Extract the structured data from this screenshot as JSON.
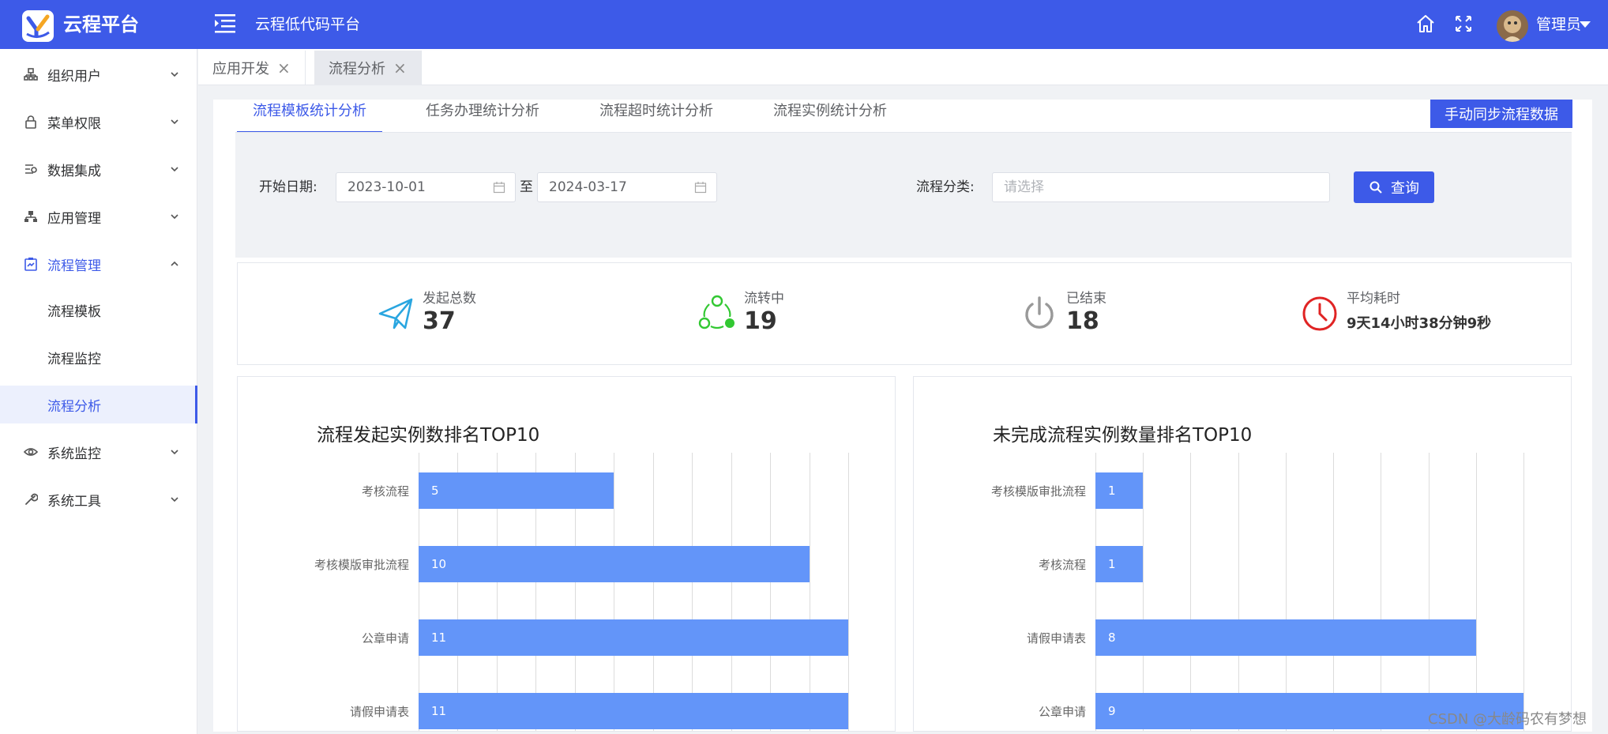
{
  "app": {
    "logo_text": "云程平台",
    "title": "云程低代码平台",
    "user": "管理员",
    "brand_color": "#3d5ae8"
  },
  "sidebar": {
    "items": [
      {
        "label": "组织用户",
        "icon": "org-icon"
      },
      {
        "label": "菜单权限",
        "icon": "lock-icon"
      },
      {
        "label": "数据集成",
        "icon": "data-icon"
      },
      {
        "label": "应用管理",
        "icon": "app-icon"
      },
      {
        "label": "流程管理",
        "icon": "flow-icon",
        "expanded": true
      },
      {
        "label": "系统监控",
        "icon": "eye-icon"
      },
      {
        "label": "系统工具",
        "icon": "wrench-icon"
      }
    ],
    "sub_items": [
      {
        "label": "流程模板"
      },
      {
        "label": "流程监控"
      },
      {
        "label": "流程分析",
        "selected": true
      }
    ]
  },
  "tabs": [
    {
      "label": "应用开发",
      "close": "×"
    },
    {
      "label": "流程分析",
      "close": "×",
      "active": true
    }
  ],
  "sub_tabs": [
    {
      "label": "流程模板统计分析",
      "active": true
    },
    {
      "label": "任务办理统计分析"
    },
    {
      "label": "流程超时统计分析"
    },
    {
      "label": "流程实例统计分析"
    }
  ],
  "sync_button": "手动同步流程数据",
  "filters": {
    "start_label": "开始日期:",
    "start_value": "2023-10-01",
    "to_label": "至",
    "end_value": "2024-03-17",
    "category_label": "流程分类:",
    "category_placeholder": "请选择",
    "query_label": "查询"
  },
  "stats": [
    {
      "label": "发起总数",
      "value": "37",
      "icon": "paper-plane-icon"
    },
    {
      "label": "流转中",
      "value": "19",
      "icon": "cycle-icon"
    },
    {
      "label": "已结束",
      "value": "18",
      "icon": "power-icon"
    },
    {
      "label": "平均耗时",
      "value": "9天14小时38分钟9秒",
      "icon": "clock-icon"
    }
  ],
  "chart_data": [
    {
      "type": "bar",
      "orientation": "horizontal",
      "title": "流程发起实例数排名TOP10",
      "categories": [
        "考核流程",
        "考核模版审批流程",
        "公章申请",
        "请假申请表"
      ],
      "values": [
        5,
        10,
        11,
        11
      ],
      "xlim": [
        0,
        11
      ],
      "grid": true,
      "color": "#6395f9"
    },
    {
      "type": "bar",
      "orientation": "horizontal",
      "title": "未完成流程实例数量排名TOP10",
      "categories": [
        "考核模版审批流程",
        "考核流程",
        "请假申请表",
        "公章申请"
      ],
      "values": [
        1,
        1,
        8,
        9
      ],
      "xlim": [
        0,
        9
      ],
      "grid": true,
      "color": "#6395f9"
    }
  ],
  "watermark": "CSDN @大龄码农有梦想"
}
